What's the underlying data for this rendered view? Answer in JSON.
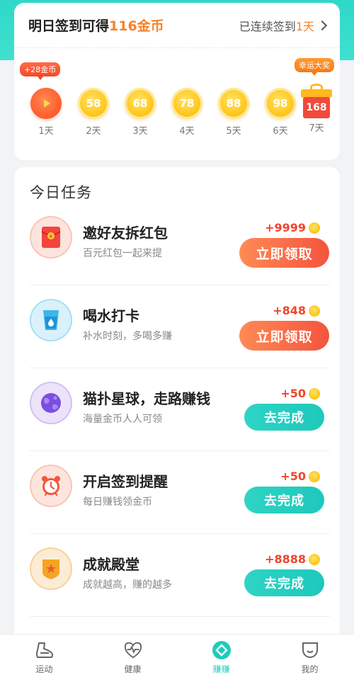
{
  "signin": {
    "title_prefix": "明日签到可得",
    "title_coins": "116金币",
    "streak_prefix": "已连续签到",
    "streak_days": "1天",
    "badge_plus": "+28金币",
    "badge_lucky": "幸运大奖",
    "days": [
      {
        "value": "",
        "label": "1天"
      },
      {
        "value": "58",
        "label": "2天"
      },
      {
        "value": "68",
        "label": "3天"
      },
      {
        "value": "78",
        "label": "4天"
      },
      {
        "value": "88",
        "label": "5天"
      },
      {
        "value": "98",
        "label": "6天"
      },
      {
        "value": "168",
        "label": "7天"
      }
    ]
  },
  "tasks": {
    "title": "今日任务",
    "items": [
      {
        "name": "邀好友拆红包",
        "desc": "百元红包一起来提",
        "reward": "+9999",
        "button": "立即领取",
        "icon": "red-envelope-icon"
      },
      {
        "name": "喝水打卡",
        "desc": "补水时刻，多喝多赚",
        "reward": "+848",
        "button": "立即领取",
        "icon": "water-cup-icon"
      },
      {
        "name": "猫扑星球，走路赚钱",
        "desc": "海量金币人人可领",
        "reward": "+50",
        "button": "去完成",
        "icon": "planet-icon"
      },
      {
        "name": "开启签到提醒",
        "desc": "每日赚钱领金币",
        "reward": "+50",
        "button": "去完成",
        "icon": "alarm-clock-icon"
      },
      {
        "name": "成就殿堂",
        "desc": "成就越高，赚的越多",
        "reward": "+8888",
        "button": "去完成",
        "icon": "medal-icon"
      }
    ]
  },
  "nav": {
    "items": [
      {
        "label": "运动",
        "icon": "shoe-icon"
      },
      {
        "label": "健康",
        "icon": "heart-pulse-icon"
      },
      {
        "label": "赚赚",
        "icon": "diamond-icon"
      },
      {
        "label": "我的",
        "icon": "profile-icon"
      }
    ]
  },
  "colors": {
    "accent": "#1fcbbd",
    "orange": "#f5832b",
    "red": "#f0452c"
  }
}
